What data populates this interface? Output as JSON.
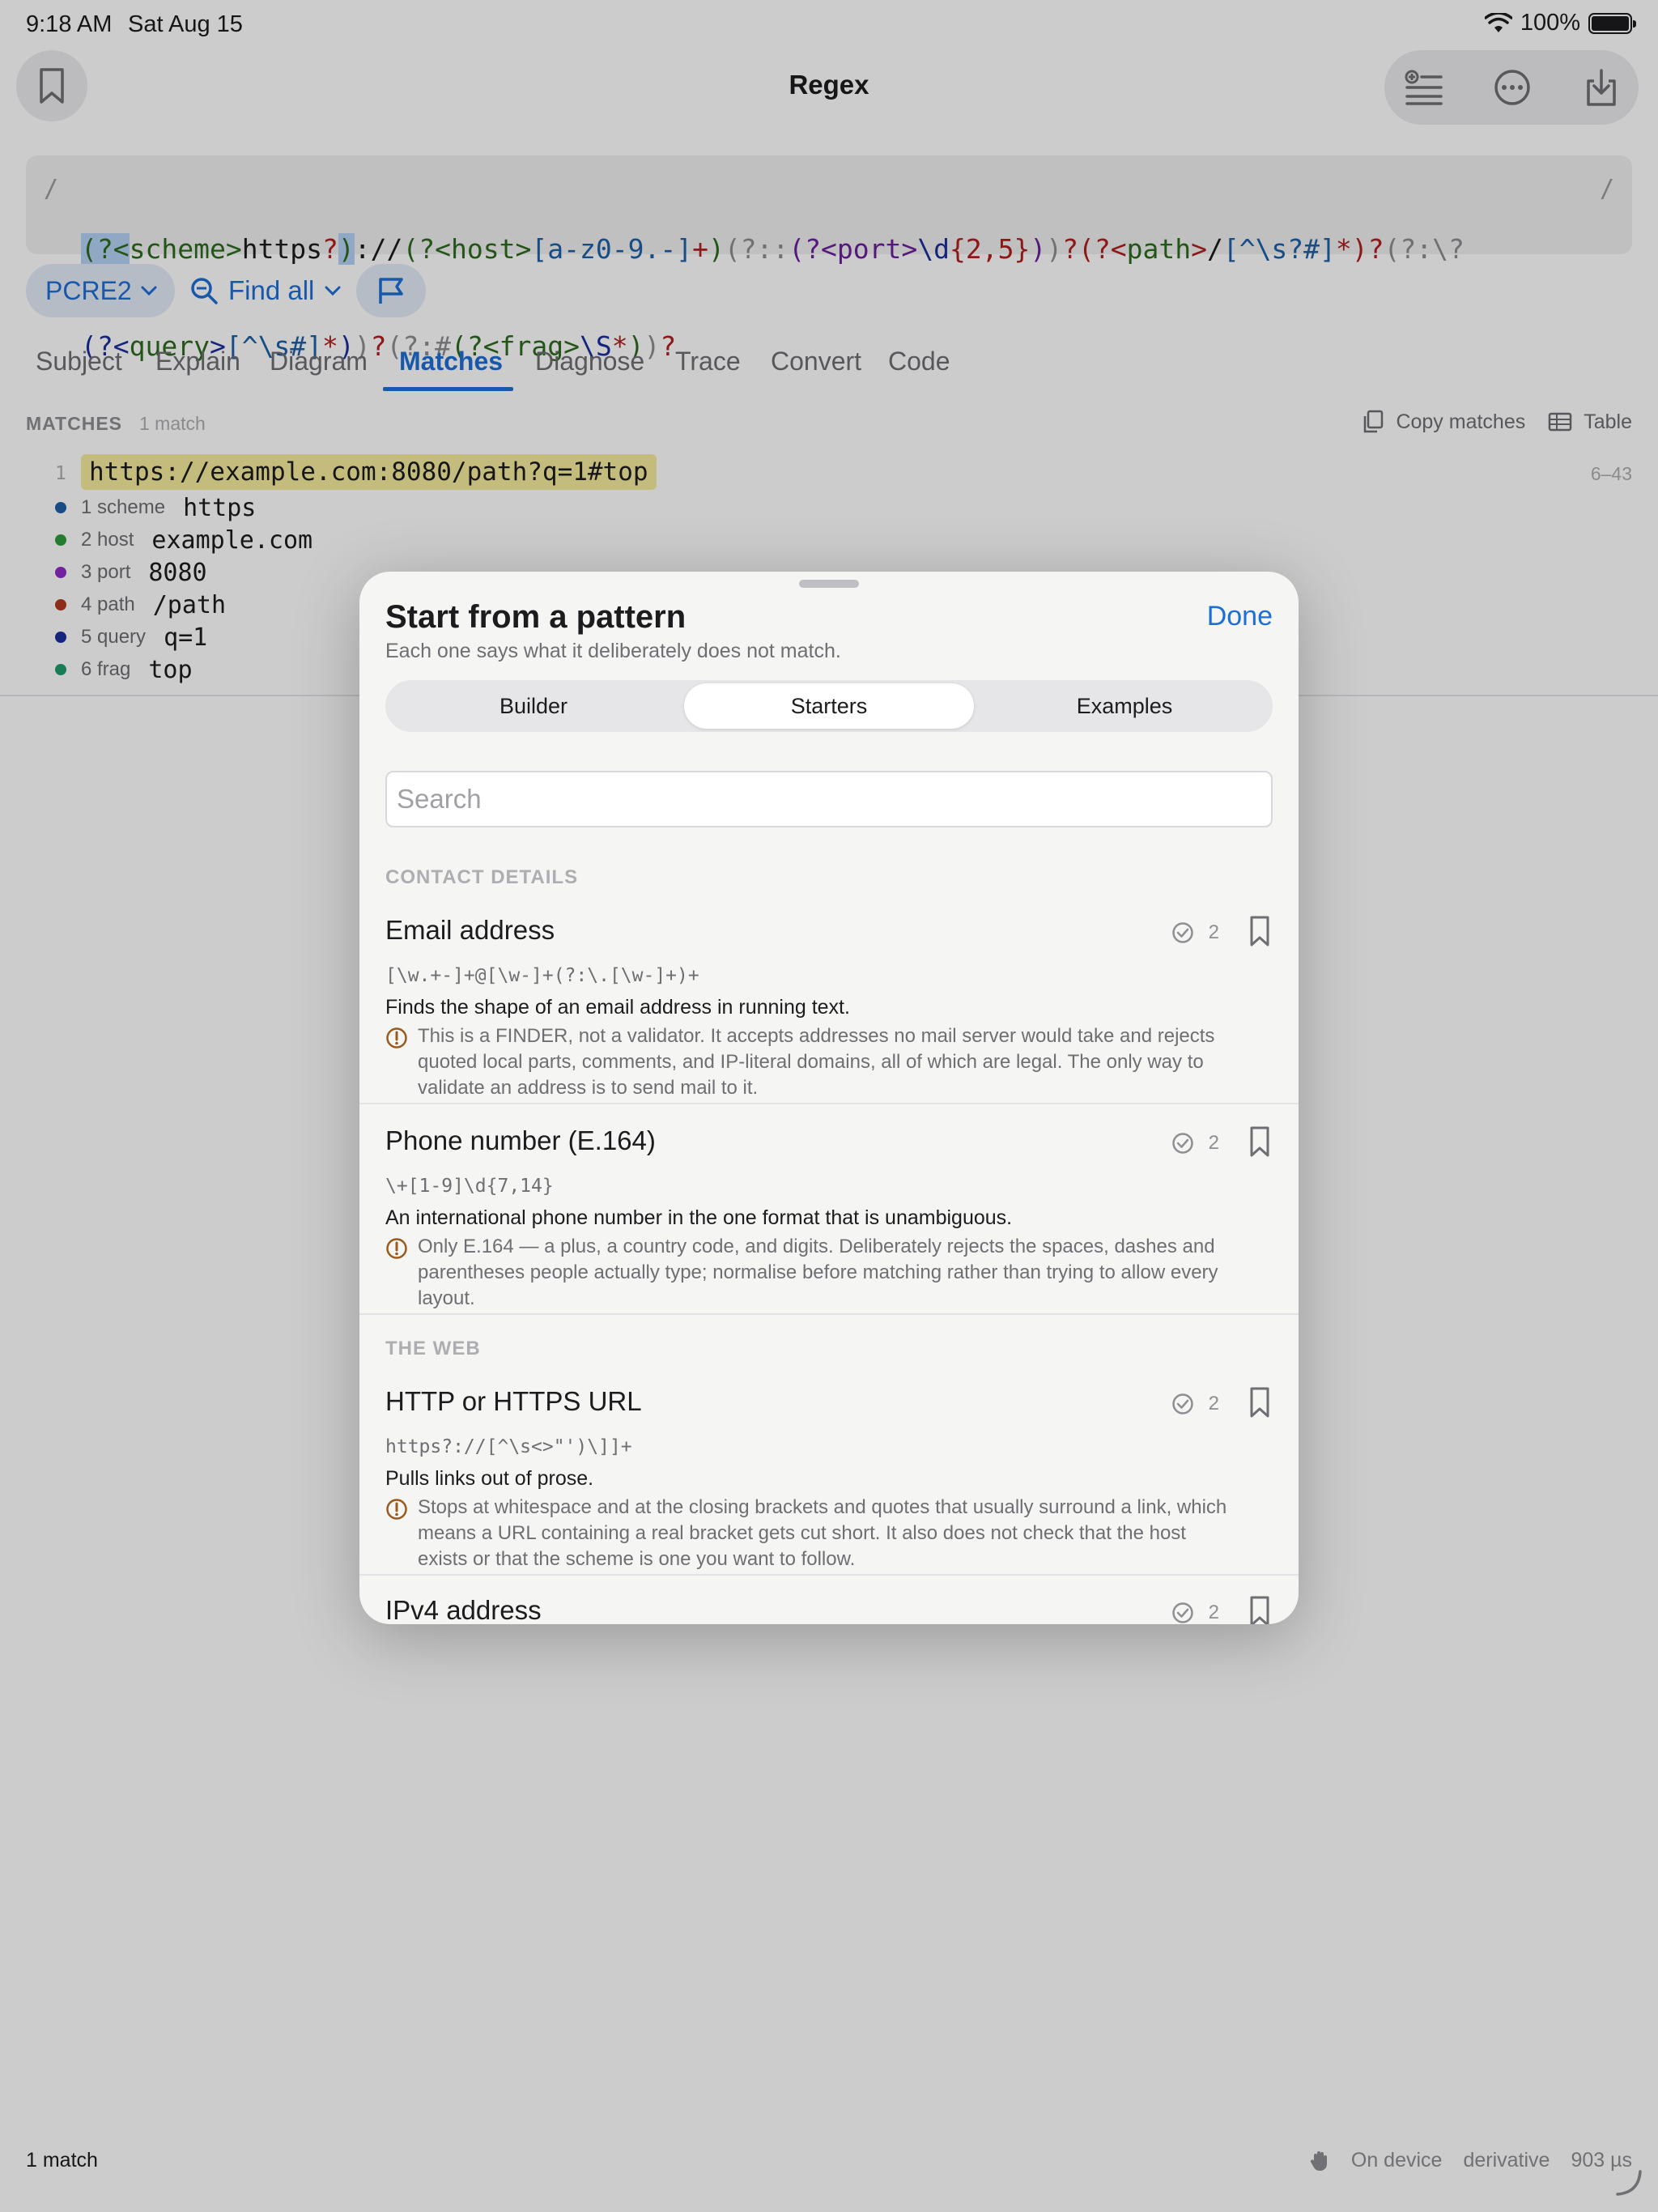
{
  "status": {
    "time": "9:18 AM",
    "date": "Sat Aug 15",
    "battery": "100%"
  },
  "nav": {
    "title": "Regex"
  },
  "pattern": {
    "delim_left": "/",
    "delim_right": "/",
    "line1": [
      {
        "t": "(?<",
        "c": "t-g",
        "sel": true
      },
      {
        "t": "scheme",
        "c": "t-g"
      },
      {
        "t": ">",
        "c": "t-g"
      },
      {
        "t": "https",
        "c": "t-k"
      },
      {
        "t": "?",
        "c": "t-r"
      },
      {
        "t": ")",
        "c": "t-g",
        "sel": true
      },
      {
        "t": "://",
        "c": "t-k"
      },
      {
        "t": "(?<",
        "c": "t-g"
      },
      {
        "t": "host",
        "c": "t-g"
      },
      {
        "t": ">",
        "c": "t-g"
      },
      {
        "t": "[a-z0-9.-]",
        "c": "t-bl"
      },
      {
        "t": "+",
        "c": "t-r"
      },
      {
        "t": ")",
        "c": "t-g"
      },
      {
        "t": "(?::",
        "c": "t-gr"
      },
      {
        "t": "(?<",
        "c": "t-p"
      },
      {
        "t": "port",
        "c": "t-p"
      },
      {
        "t": ">",
        "c": "t-p"
      },
      {
        "t": "\\d",
        "c": "t-b"
      },
      {
        "t": "{2,5}",
        "c": "t-r"
      },
      {
        "t": ")",
        "c": "t-p"
      },
      {
        "t": ")",
        "c": "t-gr"
      },
      {
        "t": "?",
        "c": "t-r"
      },
      {
        "t": "(?<",
        "c": "t-r"
      },
      {
        "t": "path",
        "c": "t-g"
      },
      {
        "t": ">",
        "c": "t-r"
      },
      {
        "t": "/",
        "c": "t-k"
      },
      {
        "t": "[^\\s?#]",
        "c": "t-bl"
      },
      {
        "t": "*",
        "c": "t-r"
      },
      {
        "t": ")",
        "c": "t-r"
      },
      {
        "t": "?",
        "c": "t-r"
      },
      {
        "t": "(?:\\?",
        "c": "t-gr"
      }
    ],
    "line2": [
      {
        "t": "(?<",
        "c": "t-b"
      },
      {
        "t": "query",
        "c": "t-g"
      },
      {
        "t": ">",
        "c": "t-b"
      },
      {
        "t": "[^\\s#]",
        "c": "t-bl"
      },
      {
        "t": "*",
        "c": "t-r"
      },
      {
        "t": ")",
        "c": "t-b"
      },
      {
        "t": ")",
        "c": "t-gr"
      },
      {
        "t": "?",
        "c": "t-r"
      },
      {
        "t": "(?:#",
        "c": "t-gr"
      },
      {
        "t": "(?<",
        "c": "t-g"
      },
      {
        "t": "frag",
        "c": "t-g"
      },
      {
        "t": ">",
        "c": "t-g"
      },
      {
        "t": "\\S",
        "c": "t-b"
      },
      {
        "t": "*",
        "c": "t-r"
      },
      {
        "t": ")",
        "c": "t-g"
      },
      {
        "t": ")",
        "c": "t-gr"
      },
      {
        "t": "?",
        "c": "t-r"
      }
    ]
  },
  "toolbar": {
    "flavor": "PCRE2",
    "find_mode": "Find all"
  },
  "tabs": [
    "Subject",
    "Explain",
    "Diagram",
    "Matches",
    "Diagnose",
    "Trace",
    "Convert",
    "Code"
  ],
  "matches": {
    "label": "MATCHES",
    "count": "1 match",
    "copy_label": "Copy matches",
    "table_label": "Table",
    "row_number": "1",
    "matched_text": "https://example.com:8080/path?q=1#top",
    "range": "6–43",
    "groups": [
      {
        "label": "1 scheme",
        "value": "https",
        "color": "#1d5fa6"
      },
      {
        "label": "2 host",
        "value": "example.com",
        "color": "#2e9c3a"
      },
      {
        "label": "3 port",
        "value": "8080",
        "color": "#8e2bc4"
      },
      {
        "label": "4 path",
        "value": "/path",
        "color": "#b03a1e"
      },
      {
        "label": "5 query",
        "value": "q=1",
        "color": "#1c2f9c"
      },
      {
        "label": "6 frag",
        "value": "top",
        "color": "#1e9c6b"
      }
    ]
  },
  "bottom": {
    "match_count": "1 match",
    "on_device": "On device",
    "derivative": "derivative",
    "timing": "903 µs"
  },
  "sheet": {
    "title": "Start from a pattern",
    "subtitle": "Each one says what it deliberately does not match.",
    "done": "Done",
    "segments": [
      "Builder",
      "Starters",
      "Examples"
    ],
    "selected_segment": "Starters",
    "search_placeholder": "Search",
    "categories": [
      {
        "name": "CONTACT DETAILS",
        "items": [
          {
            "name": "Email address",
            "count": "2",
            "pattern": "[\\w.+-]+@[\\w-]+(?:\\.[\\w-]+)+",
            "description": "Finds the shape of an email address in running text.",
            "warning": "This is a FINDER, not a validator. It accepts addresses no mail server would take and rejects quoted local parts, comments, and IP-literal domains, all of which are legal. The only way to validate an address is to send mail to it."
          },
          {
            "name": "Phone number (E.164)",
            "count": "2",
            "pattern": "\\+[1-9]\\d{7,14}",
            "description": "An international phone number in the one format that is unambiguous.",
            "warning": "Only E.164 — a plus, a country code, and digits. Deliberately rejects the spaces, dashes and parentheses people actually type; normalise before matching rather than trying to allow every layout."
          }
        ]
      },
      {
        "name": "THE WEB",
        "items": [
          {
            "name": "HTTP or HTTPS URL",
            "count": "2",
            "pattern": "https?://[^\\s<>\"')\\]]+",
            "description": "Pulls links out of prose.",
            "warning": "Stops at whitespace and at the closing brackets and quotes that usually surround a link, which means a URL containing a real bracket gets cut short. It also does not check that the host exists or that the scheme is one you want to follow."
          },
          {
            "name": "IPv4 address",
            "count": "2"
          }
        ]
      }
    ]
  }
}
